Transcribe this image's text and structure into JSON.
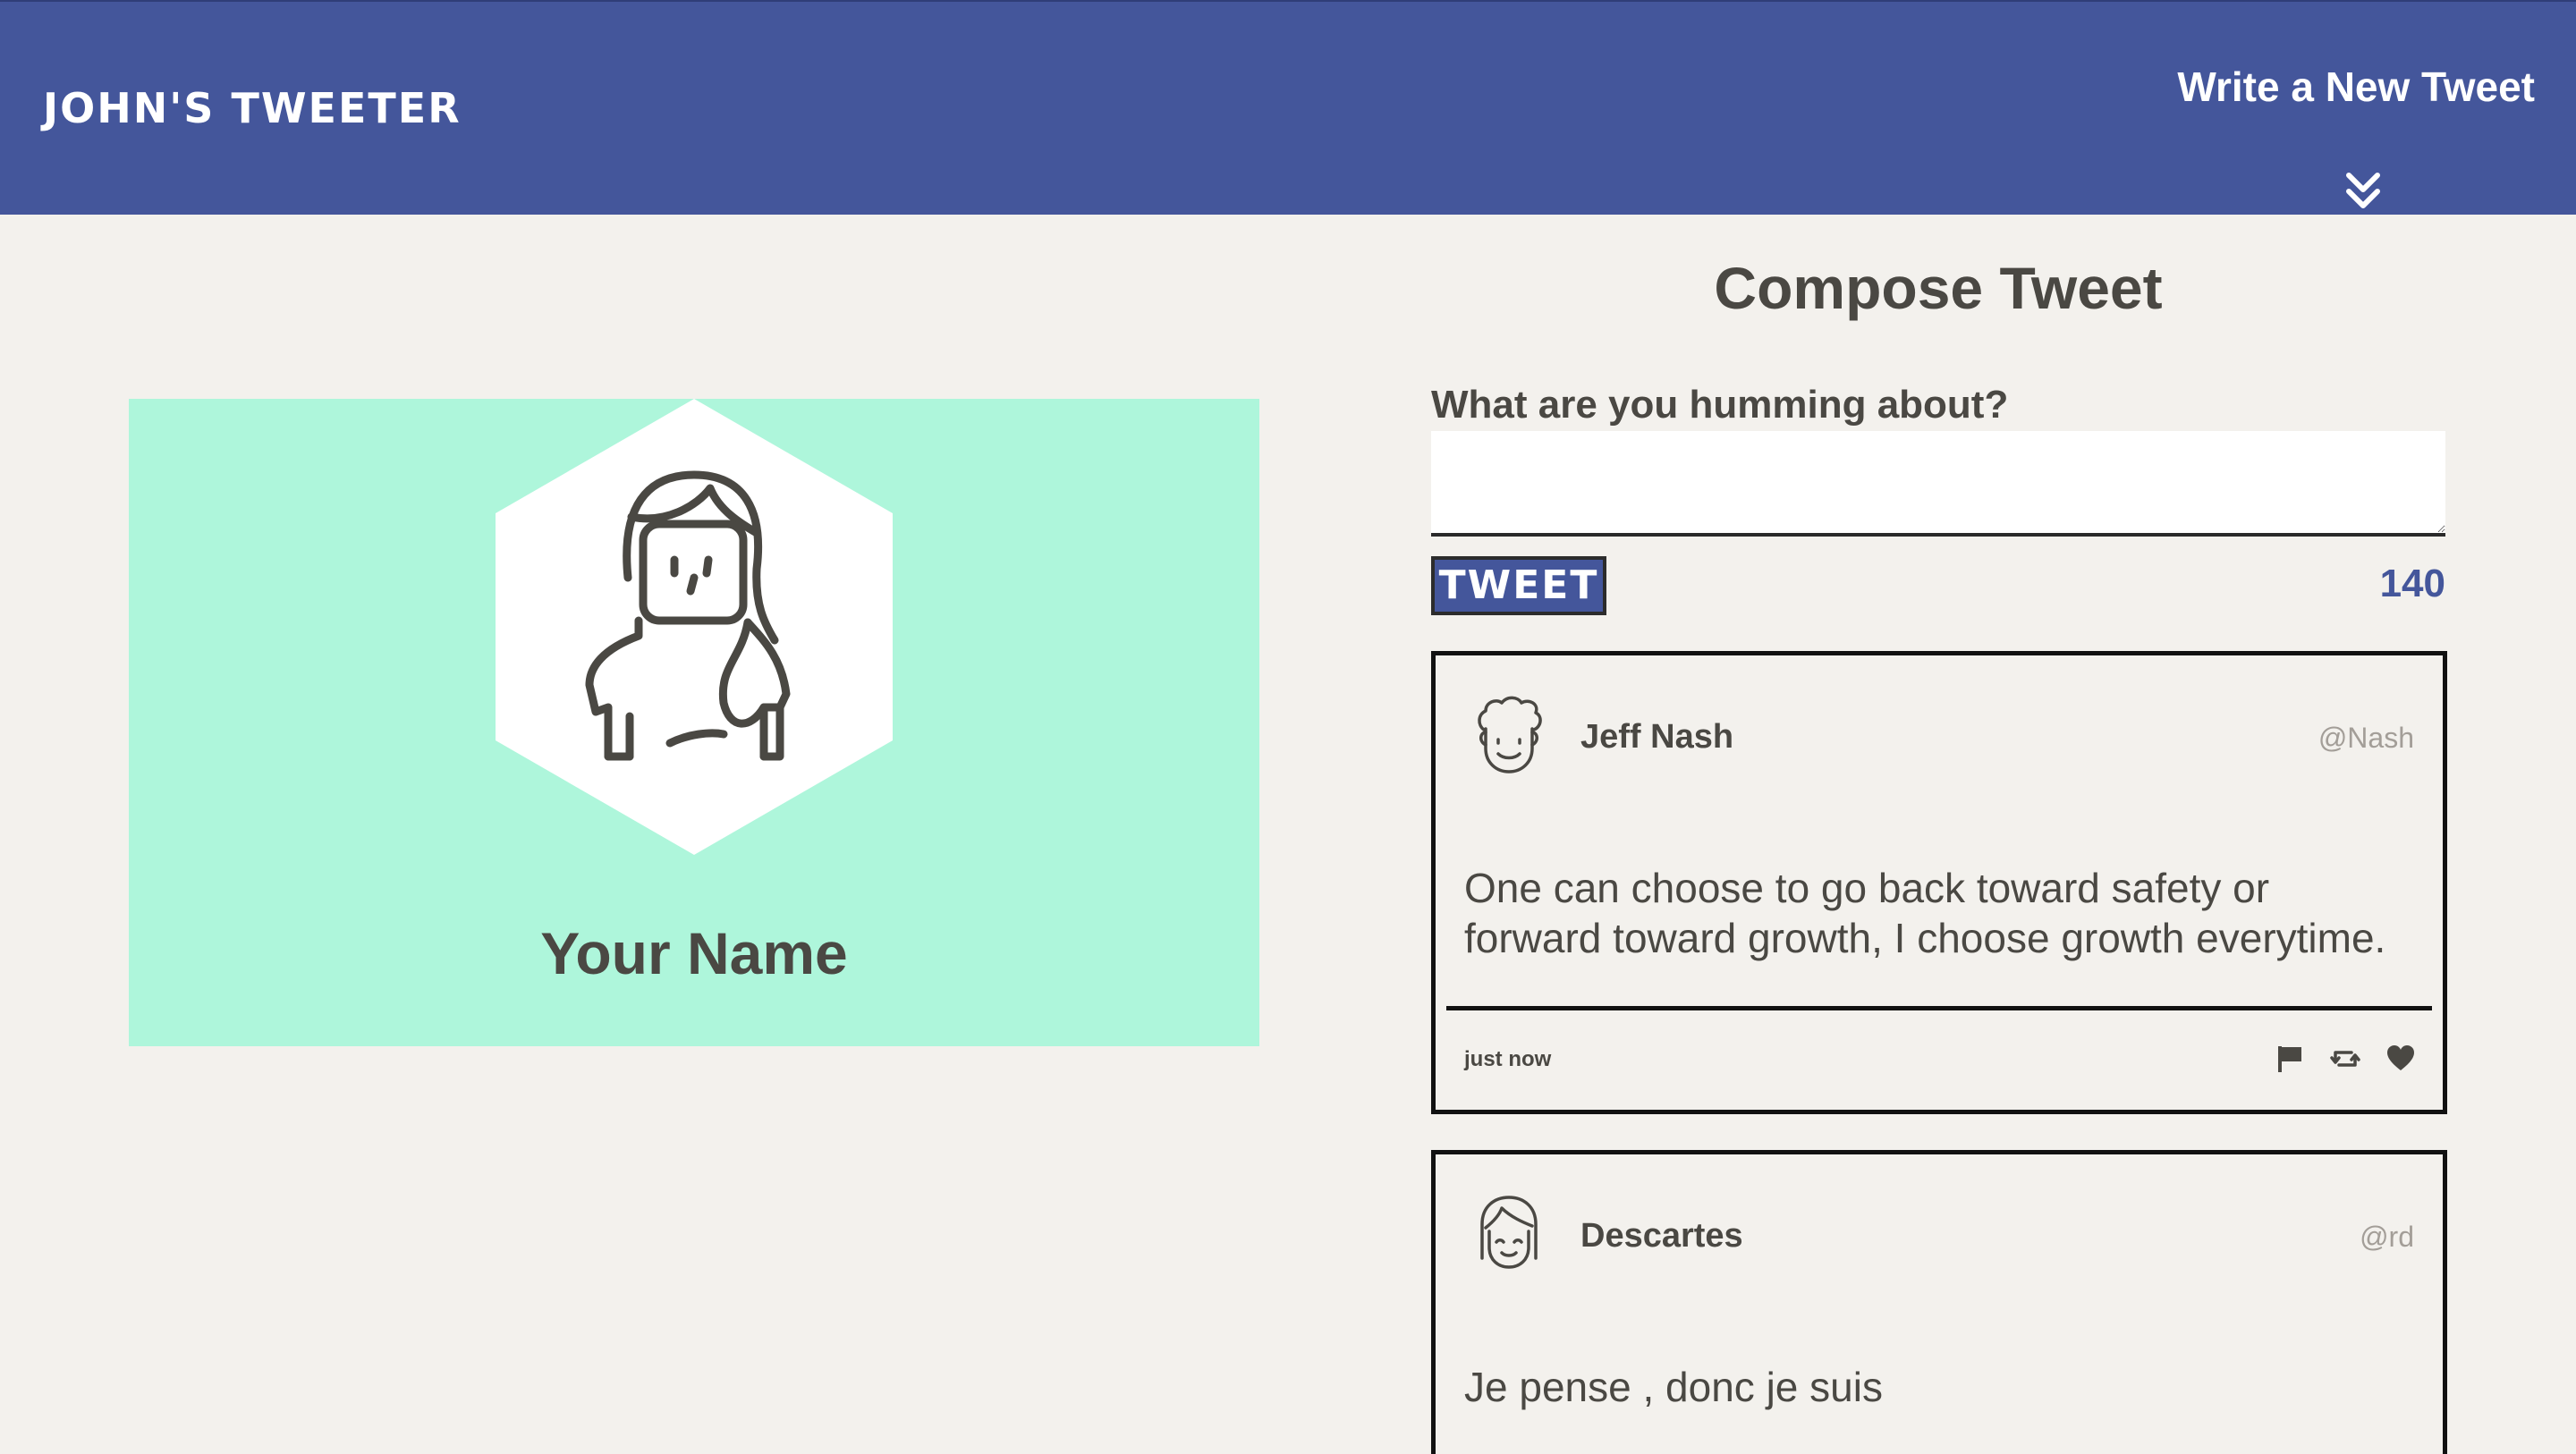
{
  "nav": {
    "brand": "JOHN'S TWEETER",
    "compose_link": "Write a New Tweet",
    "toggle_icon": "double-chevron-down-icon"
  },
  "profile": {
    "name": "Your Name",
    "background_color": "#aef6db",
    "avatar_icon": "woman-avatar-icon"
  },
  "compose": {
    "title": "Compose Tweet",
    "label": "What are you humming about?",
    "input_value": "",
    "button_label": "TWEET",
    "char_count": "140"
  },
  "tweets": [
    {
      "name": "Jeff Nash",
      "handle": "@Nash",
      "text": "One can choose to go back toward safety or forward toward growth, I choose growth everytime.",
      "time": "just now",
      "avatar_icon": "curly-hair-man-avatar-icon"
    },
    {
      "name": "Descartes",
      "handle": "@rd",
      "text": "Je pense , donc je suis",
      "avatar_icon": "bob-hair-avatar-icon"
    }
  ],
  "colors": {
    "nav": "#44569b",
    "background": "#f3f1ed",
    "text": "#4a4843",
    "accent": "#44569b"
  }
}
